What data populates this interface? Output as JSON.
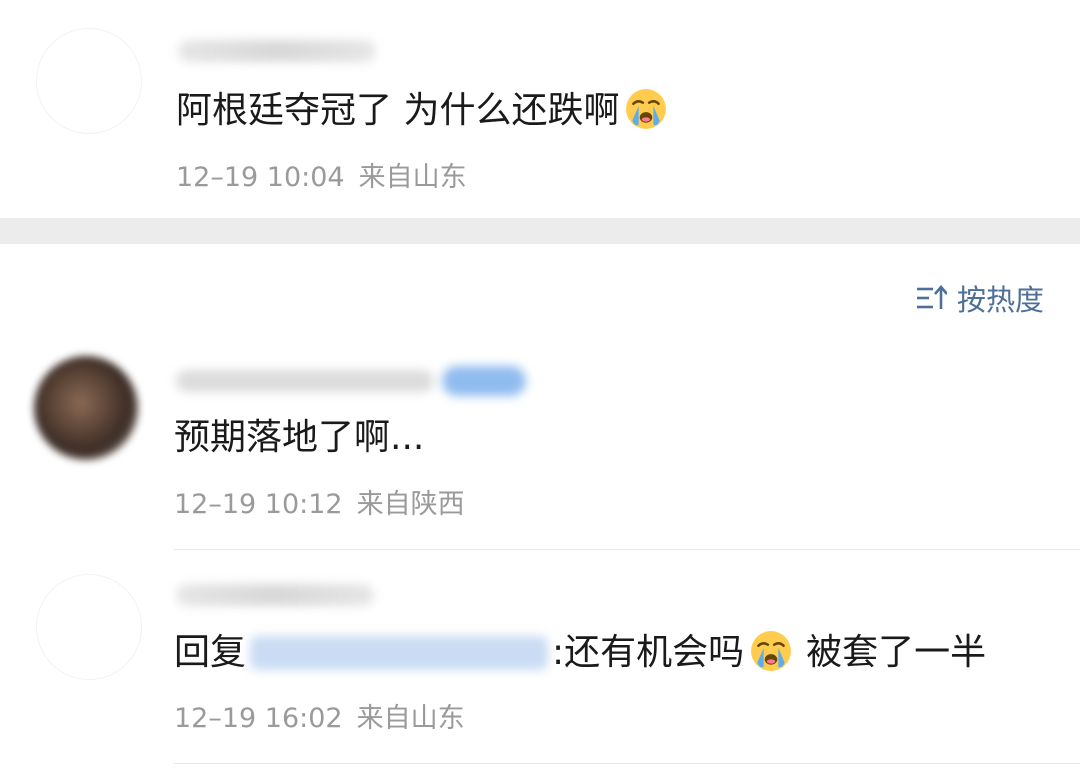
{
  "post": {
    "text": "阿根廷夺冠了 为什么还跌啊",
    "emoji": "crying-face",
    "time": "12–19 10:04",
    "location": "来自山东"
  },
  "sort": {
    "label": "按热度",
    "icon": "sort-icon"
  },
  "comments": [
    {
      "text": "预期落地了啊...",
      "time": "12–19 10:12",
      "location": "来自陕西"
    },
    {
      "reply_prefix": "回复",
      "reply_suffix": ":还有机会吗",
      "reply_tail": "被套了一半",
      "emoji": "crying-face",
      "time": "12–19 16:02",
      "location": "来自山东"
    }
  ],
  "colors": {
    "accent": "#4e6f98",
    "meta": "#9a9a9a",
    "band": "#ececec"
  }
}
